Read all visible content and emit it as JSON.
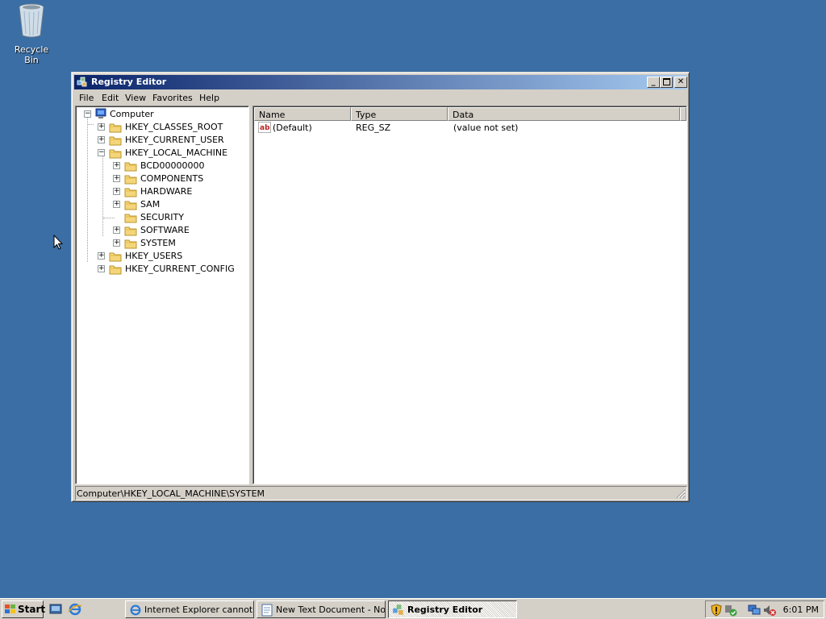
{
  "desktop": {
    "recycle_bin_label": "Recycle Bin"
  },
  "window": {
    "title": "Registry Editor",
    "menu": [
      "File",
      "Edit",
      "View",
      "Favorites",
      "Help"
    ],
    "tree": [
      {
        "label": "Computer",
        "expander": "−"
      },
      {
        "label": "HKEY_CLASSES_ROOT",
        "expander": "+"
      },
      {
        "label": "HKEY_CURRENT_USER",
        "expander": "+"
      },
      {
        "label": "HKEY_LOCAL_MACHINE",
        "expander": "−"
      },
      {
        "label": "BCD00000000",
        "expander": "+"
      },
      {
        "label": "COMPONENTS",
        "expander": "+"
      },
      {
        "label": "HARDWARE",
        "expander": "+"
      },
      {
        "label": "SAM",
        "expander": "+"
      },
      {
        "label": "SECURITY",
        "expander": ""
      },
      {
        "label": "SOFTWARE",
        "expander": "+"
      },
      {
        "label": "SYSTEM",
        "expander": "+"
      },
      {
        "label": "HKEY_USERS",
        "expander": "+"
      },
      {
        "label": "HKEY_CURRENT_CONFIG",
        "expander": "+"
      }
    ],
    "columns": [
      "Name",
      "Type",
      "Data"
    ],
    "values": [
      {
        "name": "(Default)",
        "type": "REG_SZ",
        "data": "(value not set)"
      }
    ],
    "status": "Computer\\HKEY_LOCAL_MACHINE\\SYSTEM"
  },
  "taskbar": {
    "start_label": "Start",
    "tasks": [
      {
        "label": "Internet Explorer cannot...",
        "active": false
      },
      {
        "label": "New Text Document - No...",
        "active": false
      },
      {
        "label": "Registry Editor",
        "active": true
      }
    ],
    "clock": "6:01 PM"
  },
  "colors": {
    "desktop": "#3a6ea5",
    "title_active_start": "#0a246a",
    "title_active_end": "#a6caf0",
    "face": "#d4d0c8"
  }
}
